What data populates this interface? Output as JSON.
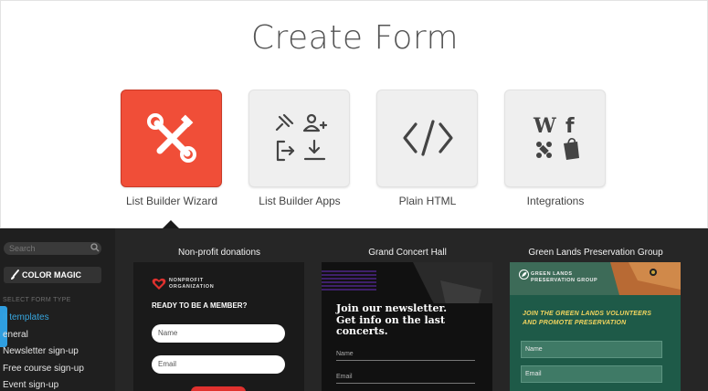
{
  "page": {
    "title": "Create Form"
  },
  "builders": [
    {
      "label": "List Builder Wizard",
      "icon": "tools-icon",
      "active": true
    },
    {
      "label": "List Builder Apps",
      "icon": "apps-icon",
      "active": false
    },
    {
      "label": "Plain HTML",
      "icon": "code-icon",
      "active": false
    },
    {
      "label": "Integrations",
      "icon": "integrations-icon",
      "active": false
    }
  ],
  "sidebar": {
    "search_placeholder": "Search",
    "color_magic_label": "COLOR MAGIC",
    "select_label": "SELECT FORM TYPE",
    "categories": [
      {
        "label": "All templates",
        "display": "ll templates",
        "active": true
      },
      {
        "label": "General",
        "display": "eneral",
        "active": false
      },
      {
        "label": "Newsletter sign-up",
        "display": "Newsletter sign-up",
        "active": false
      },
      {
        "label": "Free course sign-up",
        "display": "Free course sign-up",
        "active": false
      },
      {
        "label": "Event sign-up",
        "display": "Event sign-up",
        "active": false
      }
    ]
  },
  "templates": [
    {
      "title": "Non-profit donations",
      "org": "NONPROFIT\nORGANIZATION",
      "org_line1": "NONPROFIT",
      "org_line2": "ORGANIZATION",
      "heading": "READY TO BE A MEMBER?",
      "fields": [
        "Name",
        "Email"
      ]
    },
    {
      "title": "Grand Concert Hall",
      "heading_line1": "Join our newsletter.",
      "heading_line2": "Get info on the last",
      "heading_line3": "concerts.",
      "fields": [
        "Name",
        "Email"
      ]
    },
    {
      "title": "Green Lands Preservation Group",
      "org_line1": "GREEN LANDS",
      "org_line2": "PRESERVATION GROUP",
      "heading_line1": "JOIN THE GREEN LANDS VOLUNTEERS",
      "heading_line2": "AND PROMOTE PRESERVATION",
      "fields": [
        "Name",
        "Email"
      ]
    }
  ],
  "colors": {
    "accent_red": "#f04e38",
    "link_blue": "#37a6de",
    "dark_bg": "#262626",
    "green_card": "#1e5a48",
    "gold_text": "#f2d55f"
  }
}
